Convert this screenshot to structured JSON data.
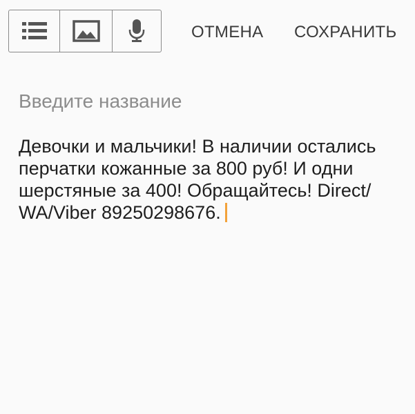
{
  "toolbar": {
    "tools": [
      {
        "name": "list-icon"
      },
      {
        "name": "image-icon"
      },
      {
        "name": "microphone-icon"
      }
    ],
    "cancel_label": "ОТМЕНА",
    "save_label": "СОХРАНИТЬ"
  },
  "editor": {
    "title_placeholder": "Введите название",
    "title_value": "",
    "body_text": "Девочки и мальчики! В наличии остались перчатки кожанные за 800 руб! И одни шерстяные за 400! Обращайтесь! Direct/ WA/Viber 89250298676.",
    "cursor_color": "#f2a23a"
  }
}
